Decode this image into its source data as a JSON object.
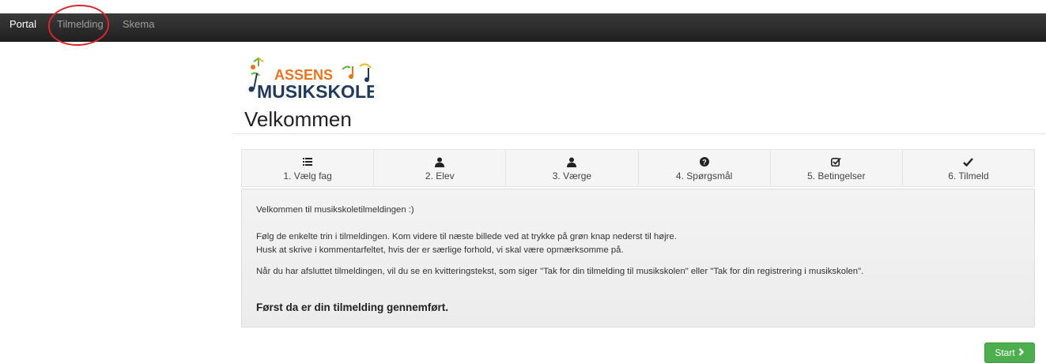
{
  "nav": {
    "items": [
      {
        "label": "Portal"
      },
      {
        "label": "Tilmelding"
      },
      {
        "label": "Skema"
      }
    ]
  },
  "logo": {
    "line1": "ASSENS",
    "line2": "MUSIKSKOLE"
  },
  "page": {
    "title": "Velkommen"
  },
  "steps": [
    {
      "label": "1. Vælg fag",
      "icon": "list-icon"
    },
    {
      "label": "2. Elev",
      "icon": "user-icon"
    },
    {
      "label": "3. Værge",
      "icon": "user-icon"
    },
    {
      "label": "4. Spørgsmål",
      "icon": "question-circle-icon"
    },
    {
      "label": "5. Betingelser",
      "icon": "check-square-icon"
    },
    {
      "label": "6. Tilmeld",
      "icon": "check-icon"
    }
  ],
  "panel": {
    "intro": "Velkommen til musikskoletilmeldingen :)",
    "line1": "Følg de enkelte trin i tilmeldingen. Kom videre til næste billede ved at trykke på grøn knap nederst til højre.",
    "line2": "Husk at skrive i kommentarfeltet, hvis der er særlige forhold, vi skal være opmærksomme på.",
    "line3": "Når du har afsluttet tilmeldingen, vil du se en kvitteringstekst, som siger \"Tak for din tilmelding til musikskolen\" eller \"Tak for din registrering i musikskolen\".",
    "emphasis": "Først da er din tilmelding gennemført."
  },
  "buttons": {
    "start": "Start"
  },
  "colors": {
    "navbar": "#222222",
    "start_green": "#4cae4c",
    "logo_orange": "#e8741e",
    "logo_dark": "#1f3b5c",
    "logo_green": "#6ab23e"
  }
}
